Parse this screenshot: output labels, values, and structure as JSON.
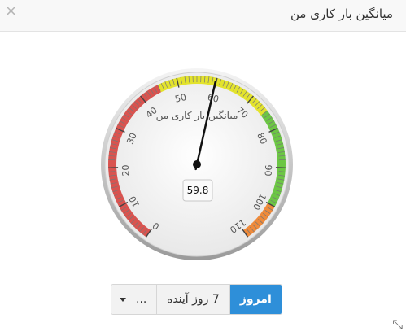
{
  "header": {
    "title": "میانگین بار کاری من",
    "close_symbol": "×"
  },
  "gauge": {
    "label": "میانگین بار کاری من",
    "min": 0,
    "max": 110,
    "value": 59.8,
    "value_text": "59.8",
    "ticks": [
      "0",
      "10",
      "20",
      "30",
      "40",
      "50",
      "60",
      "70",
      "80",
      "90",
      "100",
      "110"
    ],
    "bands": [
      {
        "from": 0,
        "to": 45,
        "color": "#d9534f"
      },
      {
        "from": 45,
        "to": 75,
        "color": "#e3e32c"
      },
      {
        "from": 75,
        "to": 100,
        "color": "#6cc644"
      },
      {
        "from": 100,
        "to": 110,
        "color": "#ef8a3a"
      }
    ]
  },
  "range_buttons": {
    "today": "امروز",
    "next7": "7 روز آینده",
    "more": "..."
  },
  "icons": {
    "close": "close-icon",
    "dropdown": "chevron-down-icon",
    "resize": "resize-icon"
  }
}
